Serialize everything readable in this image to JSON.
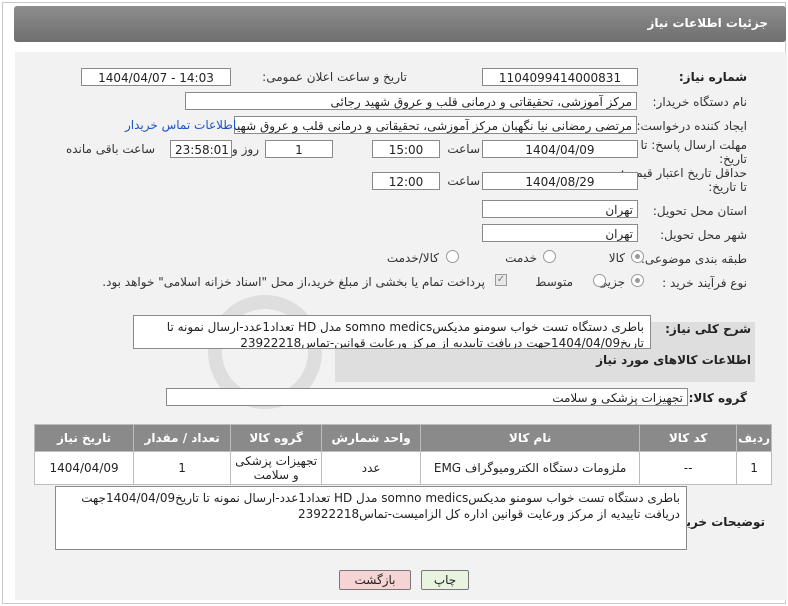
{
  "header": {
    "title": "جزئیات اطلاعات نیاز"
  },
  "fields": {
    "need_number_label": "شماره نیاز:",
    "need_number": "1104099414000831",
    "announce_label": "تاریخ و ساعت اعلان عمومی:",
    "announce_value": "1404/04/07 - 14:03",
    "buyer_org_label": "نام دستگاه خریدار:",
    "buyer_org": "مرکز آموزشی، تحقیقاتی و درمانی قلب و عروق شهید رجائی",
    "creator_label": "ایجاد کننده درخواست:",
    "creator": "مرتضی رمضانی نیا نگهبان مرکز آموزشی، تحقیقاتی و درمانی قلب و عروق شهید",
    "buyer_contact_link": "اطلاعات تماس خریدار",
    "reply_deadline_label_1": "مهلت ارسال پاسخ: تا",
    "reply_deadline_label_2": "تاریخ:",
    "reply_date": "1404/04/09",
    "time_label": "ساعت",
    "reply_time": "15:00",
    "days_value": "1",
    "days_label": "روز و",
    "remaining_time": "23:58:01",
    "remaining_label": "ساعت باقی مانده",
    "price_validity_label_1": "حداقل تاریخ اعتبار قیمت:",
    "price_validity_label_2": "تا تاریخ:",
    "price_date": "1404/08/29",
    "price_time": "12:00",
    "province_label": "استان محل تحویل:",
    "province": "تهران",
    "city_label": "شهر محل تحویل:",
    "city": "تهران",
    "category_label": "طبقه بندی موضوعی:",
    "category_options": [
      "کالا",
      "خدمت",
      "کالا/خدمت"
    ],
    "process_label": "نوع فرآیند خرید :",
    "process_options": [
      "جزیی",
      "متوسط"
    ],
    "payment_note": "پرداخت تمام یا بخشی از مبلغ خرید،از محل \"اسناد خزانه اسلامی\" خواهد بود.",
    "desc_label": "شرح کلی نیاز:",
    "desc": "باطری دستگاه تست خواب سومنو مدیکسsomno medics مدل HD تعداد1عدد-ارسال نمونه تا تاریخ1404/04/09جهت دریافت تاییدیه از مرکز ورعایت قوانین-تماس23922218",
    "goods_info_title": "اطلاعات کالاهای مورد نیاز",
    "goods_group_label": "گروه کالا:",
    "goods_group": "تجهیزات پزشکی و سلامت"
  },
  "table": {
    "headers": [
      "ردیف",
      "کد کالا",
      "نام کالا",
      "واحد شمارش",
      "گروه کالا",
      "تعداد / مقدار",
      "تاریخ نیاز"
    ],
    "rows": [
      [
        "1",
        "--",
        "ملزومات دستگاه الکترومیوگراف EMG",
        "عدد",
        "تجهیزات پزشکی و سلامت",
        "1",
        "1404/04/09"
      ]
    ]
  },
  "buyer_notes_label": "توضیحات خریدار:",
  "buyer_notes": "باطری دستگاه تست خواب سومنو مدیکسsomno medics مدل HD تعداد1عدد-ارسال نمونه تا تاریخ1404/04/09جهت دریافت تاییدیه از مرکز ورعایت قوانین اداره کل الزامیست-تماس23922218",
  "buttons": {
    "print": "چاپ",
    "back": "بازگشت"
  },
  "colors": {
    "title_bar": "#7a7a7a",
    "link": "#1a55c8",
    "back_button": "#f7d4d4",
    "print_button": "#e8f3e0"
  }
}
